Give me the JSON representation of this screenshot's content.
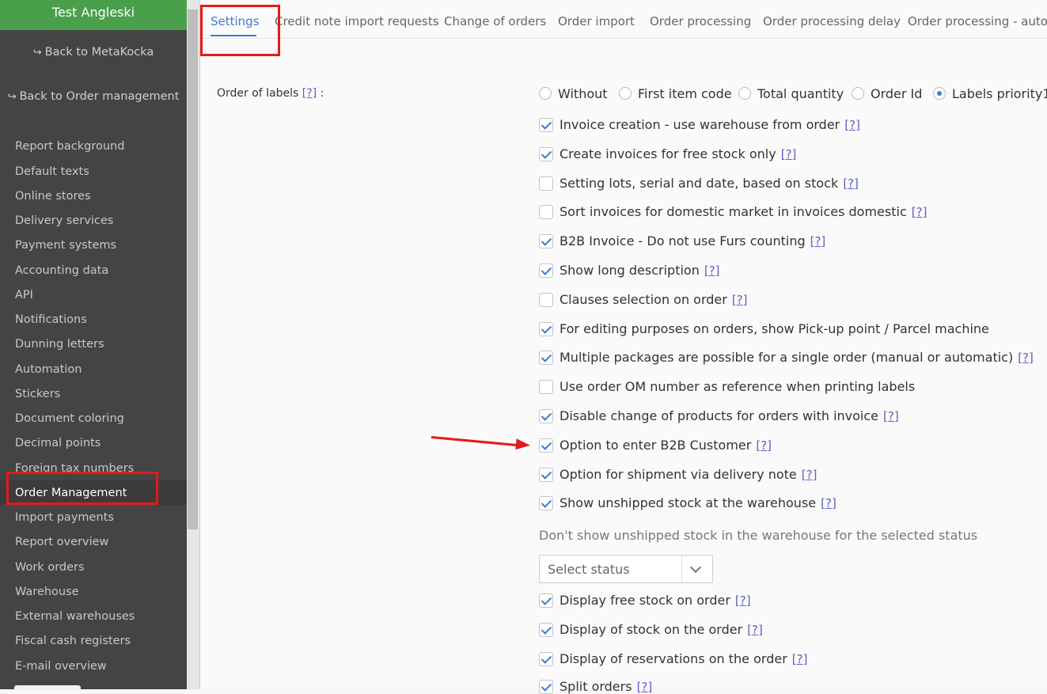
{
  "sidebar": {
    "company": "Test Angleski",
    "back_metakocka": "Back to MetaKocka",
    "back_order_mgmt": "Back to Order management",
    "items": [
      "Report background",
      "Default texts",
      "Online stores",
      "Delivery services",
      "Payment systems",
      "Accounting data",
      "API",
      "Notifications",
      "Dunning letters",
      "Automation",
      "Stickers",
      "Document coloring",
      "Decimal points",
      "Foreign tax numbers",
      "Order Management",
      "Import payments",
      "Report overview",
      "Work orders",
      "Warehouse",
      "External warehouses",
      "Fiscal cash registers",
      "E-mail overview"
    ],
    "active_item": "Order Management"
  },
  "tabs": [
    "Settings",
    "Credit note import requests",
    "Change of orders",
    "Order import",
    "Order processing",
    "Order processing delay",
    "Order processing - automa"
  ],
  "active_tab": "Settings",
  "help_marker": "[?]",
  "order_of_labels": {
    "label": "Order of labels",
    "suffix": ":",
    "options": [
      "Without",
      "First item code",
      "Total quantity",
      "Order Id",
      "Labels priority1"
    ],
    "selected": "Labels priority1"
  },
  "checkboxes": [
    {
      "label": "Invoice creation - use warehouse from order",
      "checked": true,
      "help": true
    },
    {
      "label": "Create invoices for free stock only",
      "checked": true,
      "help": true
    },
    {
      "label": "Setting lots, serial and date, based on stock",
      "checked": false,
      "help": true
    },
    {
      "label": "Sort invoices for domestic market in invoices domestic",
      "checked": false,
      "help": true
    },
    {
      "label": "B2B Invoice - Do not use Furs counting",
      "checked": true,
      "help": true
    },
    {
      "label": "Show long description",
      "checked": true,
      "help": true
    },
    {
      "label": "Clauses selection on order",
      "checked": false,
      "help": true
    },
    {
      "label": "For editing purposes on orders, show Pick-up point / Parcel machine",
      "checked": true,
      "help": false
    },
    {
      "label": "Multiple packages are possible for a single order (manual or automatic)",
      "checked": true,
      "help": true
    },
    {
      "label": "Use order OM number as reference when printing labels",
      "checked": false,
      "help": false
    },
    {
      "label": "Disable change of products for orders with invoice",
      "checked": true,
      "help": true
    },
    {
      "label": "Option to enter B2B Customer",
      "checked": true,
      "help": true
    },
    {
      "label": "Option for shipment via delivery note",
      "checked": true,
      "help": true
    },
    {
      "label": "Show unshipped stock at the warehouse",
      "checked": true,
      "help": true
    }
  ],
  "unshipped_status": {
    "label": "Don't show unshipped stock in the warehouse for the selected status",
    "placeholder": "Select status"
  },
  "checkboxes_after": [
    {
      "label": "Display free stock on order",
      "checked": true,
      "help": true
    },
    {
      "label": "Display of stock on the order",
      "checked": true,
      "help": true
    },
    {
      "label": "Display of reservations on the order",
      "checked": true,
      "help": true
    },
    {
      "label": "Split orders",
      "checked": true,
      "help": true
    }
  ],
  "colors": {
    "sidebar_bg": "#444445",
    "company_bg": "#4aa04a",
    "accent": "#3a7bd5",
    "annotation": "#e31b1b",
    "help_link": "#5d5dc9"
  }
}
